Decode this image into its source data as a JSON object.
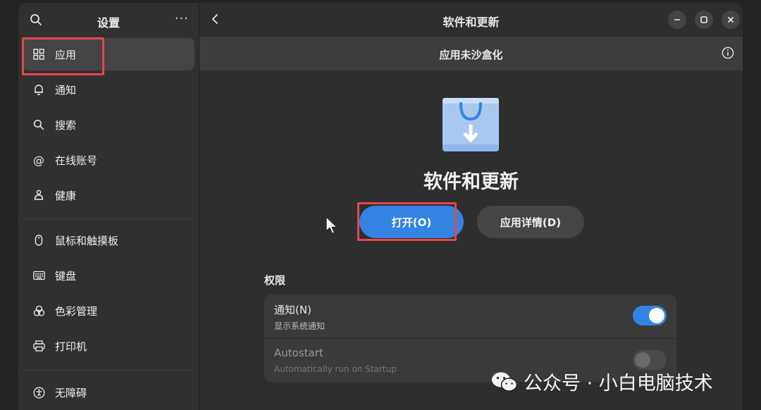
{
  "sidebar": {
    "title": "设置",
    "menu_glyph": "···",
    "items": [
      {
        "label": "应用",
        "icon": "apps-icon"
      },
      {
        "label": "通知",
        "icon": "bell-icon"
      },
      {
        "label": "搜索",
        "icon": "search-icon"
      },
      {
        "label": "在线账号",
        "icon": "at-icon"
      },
      {
        "label": "健康",
        "icon": "wellbeing-icon"
      },
      {
        "label": "鼠标和触摸板",
        "icon": "mouse-icon"
      },
      {
        "label": "键盘",
        "icon": "keyboard-icon"
      },
      {
        "label": "色彩管理",
        "icon": "color-icon"
      },
      {
        "label": "打印机",
        "icon": "printer-icon"
      },
      {
        "label": "无障碍",
        "icon": "accessibility-icon"
      }
    ]
  },
  "header": {
    "title": "软件和更新",
    "subtitle": "应用未沙盒化"
  },
  "app": {
    "name": "软件和更新",
    "open_label": "打开(O)",
    "details_label": "应用详情(D)"
  },
  "permissions": {
    "title": "权限",
    "rows": [
      {
        "title": "通知(N)",
        "subtitle": "显示系统通知",
        "enabled": true
      },
      {
        "title": "Autostart",
        "subtitle": "Automatically run on Startup",
        "enabled": false
      }
    ]
  },
  "watermark": {
    "text": "公众号 · 小白电脑技术"
  },
  "colors": {
    "accent": "#3584e4",
    "highlight": "#e4474f",
    "sidebar_bg": "#303030",
    "main_bg": "#2e2e2e"
  }
}
